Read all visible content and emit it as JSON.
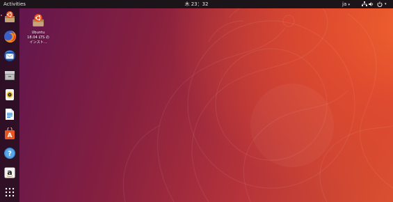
{
  "topbar": {
    "activities_label": "Activities",
    "clock": "木 23：32",
    "input_method": "ja",
    "tray_icons": [
      "network-icon",
      "volume-icon",
      "power-icon",
      "chevron-down-icon"
    ]
  },
  "dock": {
    "items": [
      {
        "name": "ubuntu-installer-icon"
      },
      {
        "name": "firefox-icon"
      },
      {
        "name": "thunderbird-icon"
      },
      {
        "name": "files-icon"
      },
      {
        "name": "rhythmbox-icon"
      },
      {
        "name": "libreoffice-writer-icon"
      },
      {
        "name": "ubuntu-software-icon"
      },
      {
        "name": "help-icon",
        "glyph": "?"
      },
      {
        "name": "amazon-icon",
        "glyph": "a"
      },
      {
        "name": "show-applications-icon"
      }
    ]
  },
  "desktop": {
    "icon_label_line1": "Ubuntu",
    "icon_label_line2": "18.04 LTS の",
    "icon_label_line3": "インスト..."
  },
  "colors": {
    "topbar": "#1b1419",
    "accent": "#e95420",
    "dock_bg": "#190c16"
  }
}
